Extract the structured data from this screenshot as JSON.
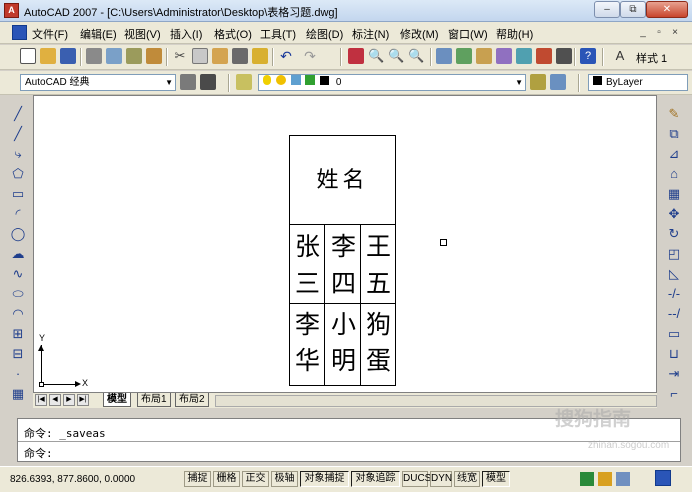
{
  "window": {
    "title": "AutoCAD 2007 - [C:\\Users\\Administrator\\Desktop\\表格习题.dwg]",
    "icon_label": "A",
    "minimize": "–",
    "restore": "⧉",
    "close": "✕"
  },
  "menu": {
    "items": [
      "文件(F)",
      "编辑(E)",
      "视图(V)",
      "插入(I)",
      "格式(O)",
      "工具(T)",
      "绘图(D)",
      "标注(N)",
      "修改(M)",
      "窗口(W)",
      "帮助(H)"
    ],
    "mdi_min": "_",
    "mdi_restore": "▫",
    "mdi_close": "×"
  },
  "toolbar": {
    "style_label": "样式 1"
  },
  "workspace": {
    "selected": "AutoCAD 经典"
  },
  "layer": {
    "selected": "0",
    "color_label": "ByLayer"
  },
  "drawing": {
    "header": "姓名",
    "rows": [
      [
        "张",
        "李",
        "王"
      ],
      [
        "三",
        "四",
        "五"
      ],
      [
        "李",
        "小",
        "狗"
      ],
      [
        "华",
        "明",
        "蛋"
      ]
    ],
    "ucs_x": "X",
    "ucs_y": "Y"
  },
  "layout_tabs": [
    "模型",
    "布局1",
    "布局2"
  ],
  "command": {
    "line1": "命令:  _saveas",
    "line2": "命令:"
  },
  "status": {
    "coords": "826.6393,  877.8600,  0.0000",
    "buttons": [
      {
        "label": "捕捉",
        "on": false
      },
      {
        "label": "栅格",
        "on": false
      },
      {
        "label": "正交",
        "on": false
      },
      {
        "label": "极轴",
        "on": false
      },
      {
        "label": "对象捕捉",
        "on": true
      },
      {
        "label": "对象追踪",
        "on": true
      },
      {
        "label": "DUCS",
        "on": false
      },
      {
        "label": "DYN",
        "on": false
      },
      {
        "label": "线宽",
        "on": false
      },
      {
        "label": "模型",
        "on": true
      }
    ]
  },
  "watermark": {
    "text": "搜狗指南",
    "url": "zhinan.sogou.com"
  }
}
